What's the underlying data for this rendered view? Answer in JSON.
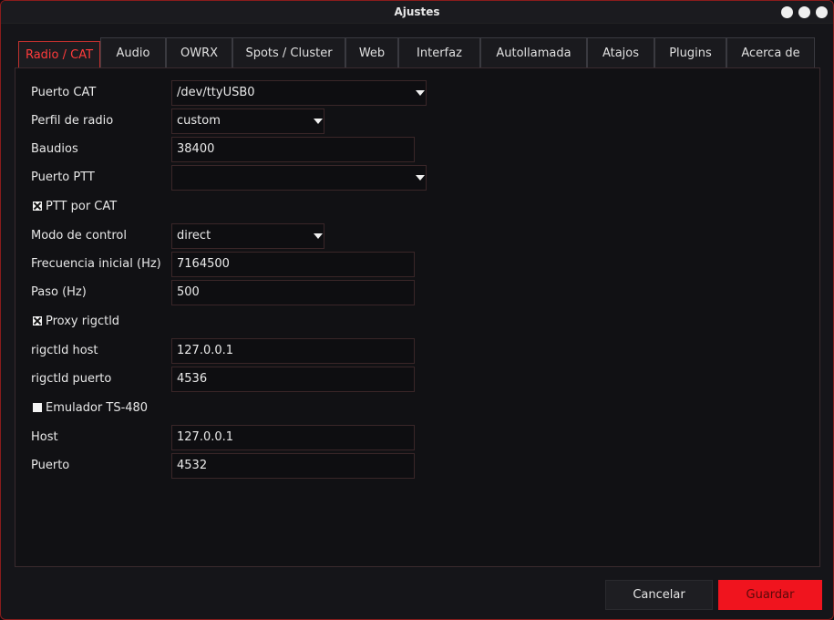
{
  "window": {
    "title": "Ajustes"
  },
  "tabs": [
    "Radio / CAT",
    "Audio",
    "OWRX",
    "Spots / Cluster",
    "Web",
    "Interfaz",
    "Autollamada",
    "Atajos",
    "Plugins",
    "Acerca de"
  ],
  "form": {
    "puerto_cat": {
      "label": "Puerto CAT",
      "value": "/dev/ttyUSB0"
    },
    "perfil_radio": {
      "label": "Perfil de radio",
      "value": "custom"
    },
    "baudios": {
      "label": "Baudios",
      "value": "38400"
    },
    "puerto_ptt": {
      "label": "Puerto PTT",
      "value": ""
    },
    "ptt_por_cat": {
      "label": "PTT por CAT",
      "checked": true
    },
    "modo_control": {
      "label": "Modo de control",
      "value": "direct"
    },
    "frecuencia_inicial": {
      "label": "Frecuencia inicial (Hz)",
      "value": "7164500"
    },
    "paso": {
      "label": "Paso (Hz)",
      "value": "500"
    },
    "proxy_rigctld": {
      "label": "Proxy rigctld",
      "checked": true
    },
    "rigctld_host": {
      "label": "rigctld host",
      "value": "127.0.0.1"
    },
    "rigctld_puerto": {
      "label": "rigctld puerto",
      "value": "4536"
    },
    "emulador_ts480": {
      "label": "Emulador TS-480",
      "checked": false
    },
    "host": {
      "label": "Host",
      "value": "127.0.0.1"
    },
    "puerto": {
      "label": "Puerto",
      "value": "4532"
    }
  },
  "buttons": {
    "cancel": "Cancelar",
    "save": "Guardar"
  },
  "colors": {
    "accent": "#f0141e",
    "background": "#151519"
  }
}
